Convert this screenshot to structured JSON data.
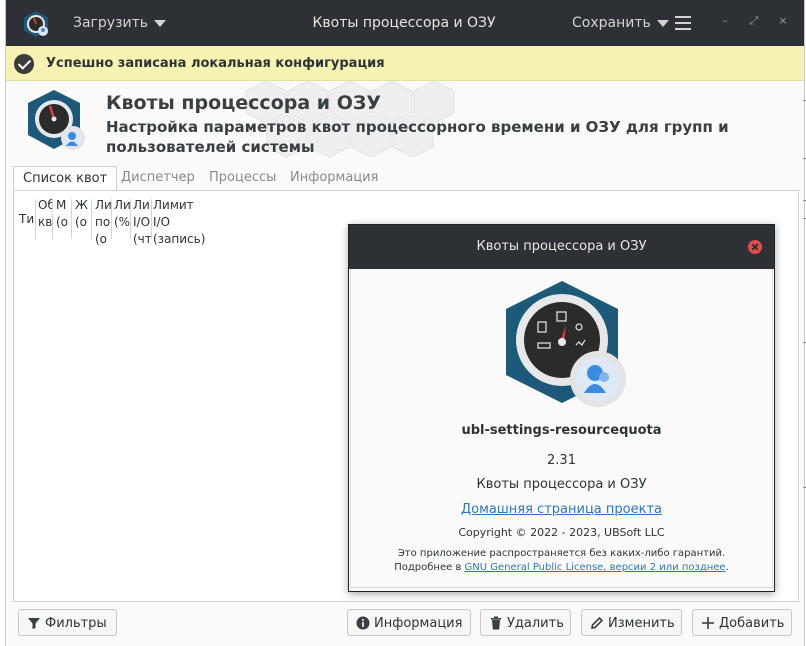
{
  "header": {
    "load_label": "Загрузить",
    "title": "Квоты процессора и ОЗУ",
    "save_label": "Сохранить"
  },
  "infobar": {
    "message": "Успешно записана локальная конфигурация"
  },
  "banner": {
    "title": "Квоты процессора и ОЗУ",
    "subtitle": "Настройка параметров квот процессорного времени и ОЗУ для групп и пользователей системы"
  },
  "tabs": [
    "Список квот",
    "Диспетчер",
    "Процессы",
    "Информация"
  ],
  "table": {
    "columns": [
      [
        "Ти"
      ],
      [
        "Об",
        "кв"
      ],
      [
        "М",
        "(о"
      ],
      [
        "Ж",
        "(о"
      ],
      [
        "Ли",
        "по",
        "(о"
      ],
      [
        "Ли",
        "(%"
      ],
      [
        "Ли",
        "I/O",
        "(чт"
      ],
      [
        "Лимит",
        "I/O",
        "(запись)"
      ]
    ]
  },
  "buttons": {
    "filters": "Фильтры",
    "info": "Информация",
    "delete": "Удалить",
    "edit": "Изменить",
    "add": "Добавить"
  },
  "about": {
    "title": "Квоты процессора и ОЗУ",
    "program_name": "ubl-settings-resourcequota",
    "version": "2.31",
    "comment": "Квоты процессора и ОЗУ",
    "website": "Домашняя страница проекта",
    "copyright": "Copyright © 2022 - 2023, UBSoft LLC",
    "license_line1": "Это приложение распространяется без каких-либо гарантий.",
    "license_prefix": "Подробнее в ",
    "license_link": "GNU General Public License, версии 2 или позднее",
    "license_suffix": "."
  },
  "colors": {
    "headerbar": "#2d3035",
    "infobar": "#f6f2b2",
    "link": "#2a76c6",
    "close": "#e64a4a",
    "logo_teal": "#1d5a7a"
  }
}
